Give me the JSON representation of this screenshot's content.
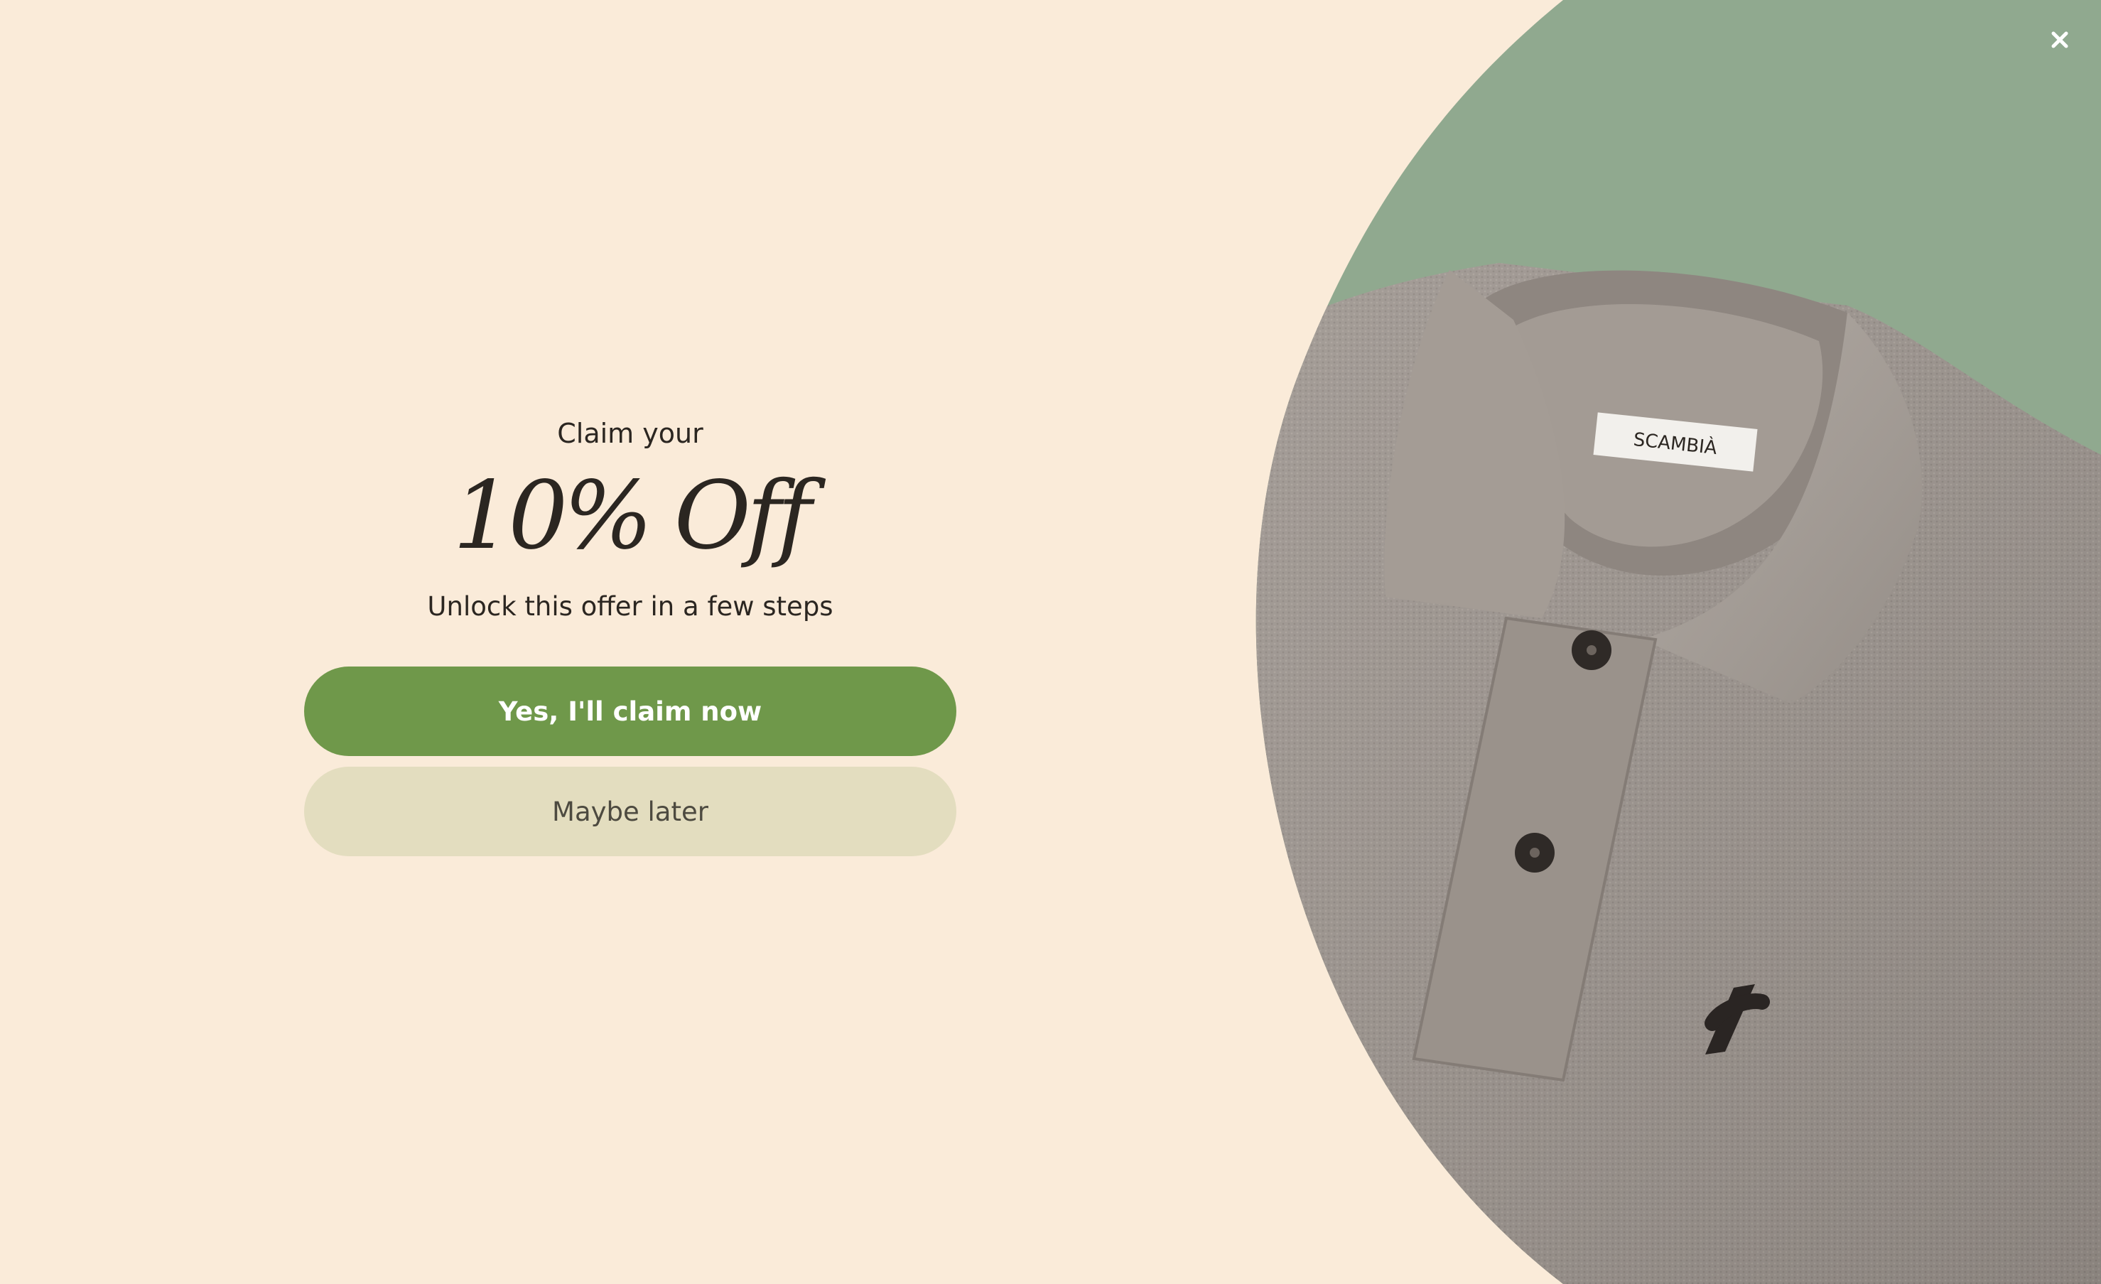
{
  "popup": {
    "eyebrow": "Claim your",
    "headline": "10% Off",
    "subtext": "Unlock this offer in a few steps",
    "primary_button": "Yes, I'll claim now",
    "secondary_button": "Maybe later",
    "close_icon": "close-icon",
    "image_label_text": "SCAMBIÀ"
  },
  "colors": {
    "background": "#faebd9",
    "primary_button": "#6f984a",
    "secondary_button": "#e3ddbf",
    "accent_green": "#90a98f",
    "shirt_grey": "#9e958e"
  }
}
